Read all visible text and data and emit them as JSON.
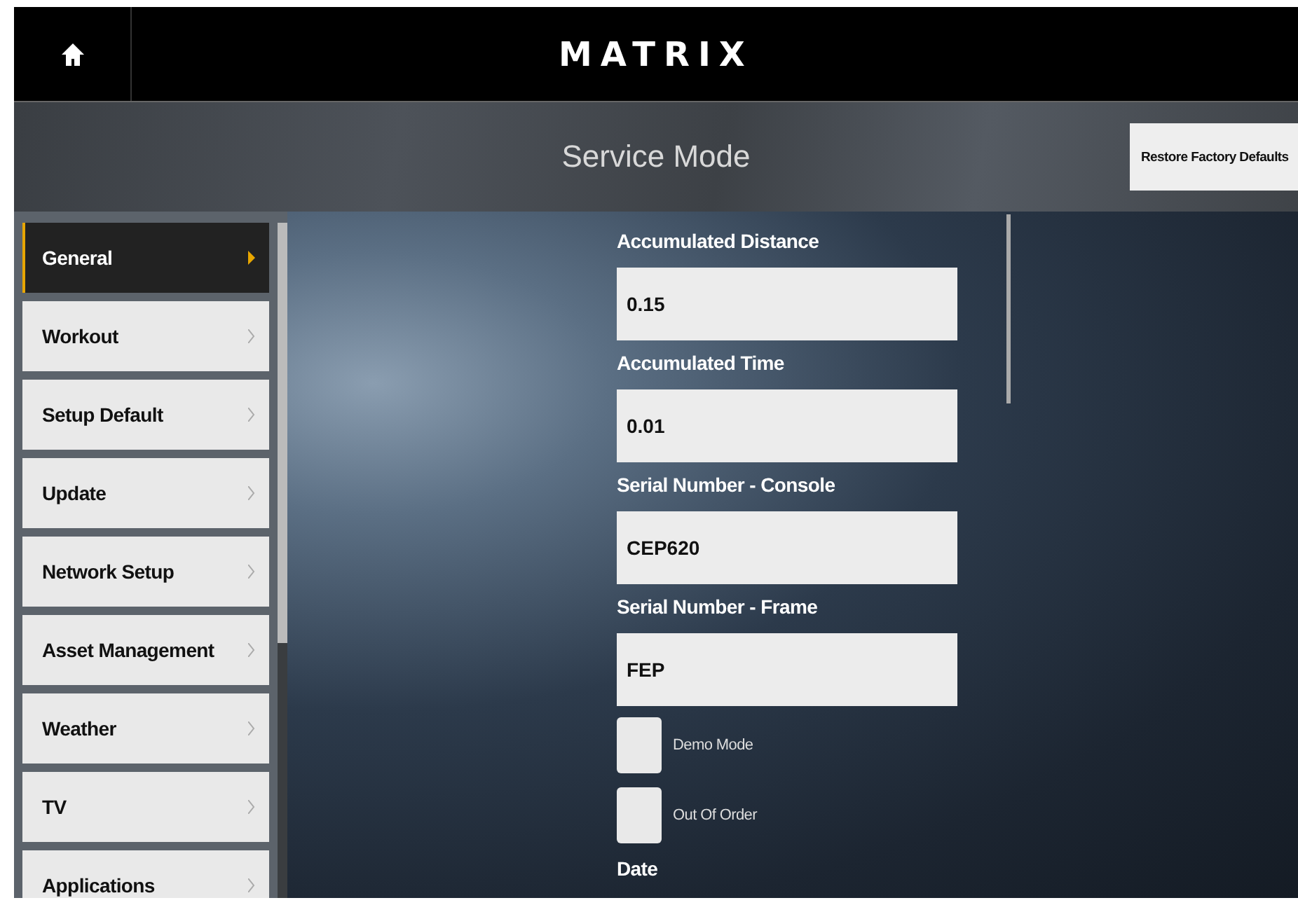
{
  "header": {
    "logo": "MATRIX"
  },
  "title_bar": {
    "title": "Service Mode",
    "action_button": "Restore Factory Defaults"
  },
  "sidebar": {
    "items": [
      {
        "label": "General",
        "selected": true
      },
      {
        "label": "Workout",
        "selected": false
      },
      {
        "label": "Setup Default",
        "selected": false
      },
      {
        "label": "Update",
        "selected": false
      },
      {
        "label": "Network Setup",
        "selected": false
      },
      {
        "label": "Asset Management",
        "selected": false
      },
      {
        "label": "Weather",
        "selected": false
      },
      {
        "label": "TV",
        "selected": false
      },
      {
        "label": "Applications",
        "selected": false
      }
    ]
  },
  "settings": [
    {
      "kind": "field",
      "label": "Accumulated Distance",
      "value": "0.15"
    },
    {
      "kind": "field",
      "label": "Accumulated Time",
      "value": "0.01"
    },
    {
      "kind": "field",
      "label": "Serial Number - Console",
      "value": "CEP620"
    },
    {
      "kind": "field",
      "label": "Serial Number - Frame",
      "value": "FEP"
    },
    {
      "kind": "checkbox",
      "label": "Demo Mode",
      "checked": false
    },
    {
      "kind": "checkbox",
      "label": "Out Of Order",
      "checked": false
    },
    {
      "kind": "heading",
      "label": "Date"
    }
  ]
}
